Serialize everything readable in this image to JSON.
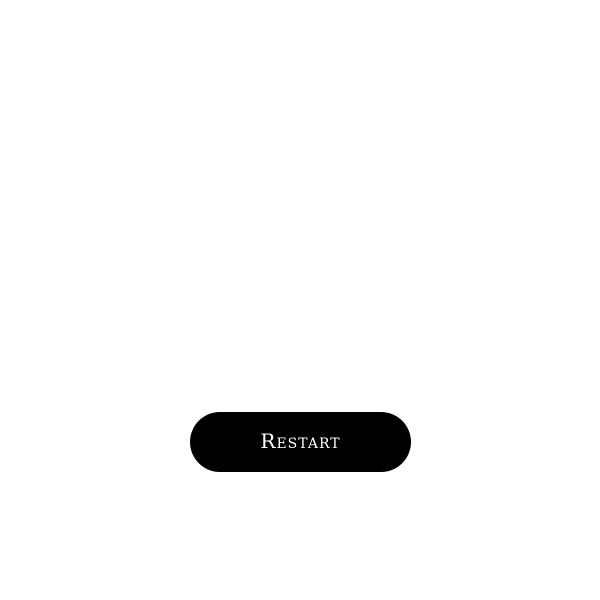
{
  "restart_button": {
    "label": "Restart"
  }
}
